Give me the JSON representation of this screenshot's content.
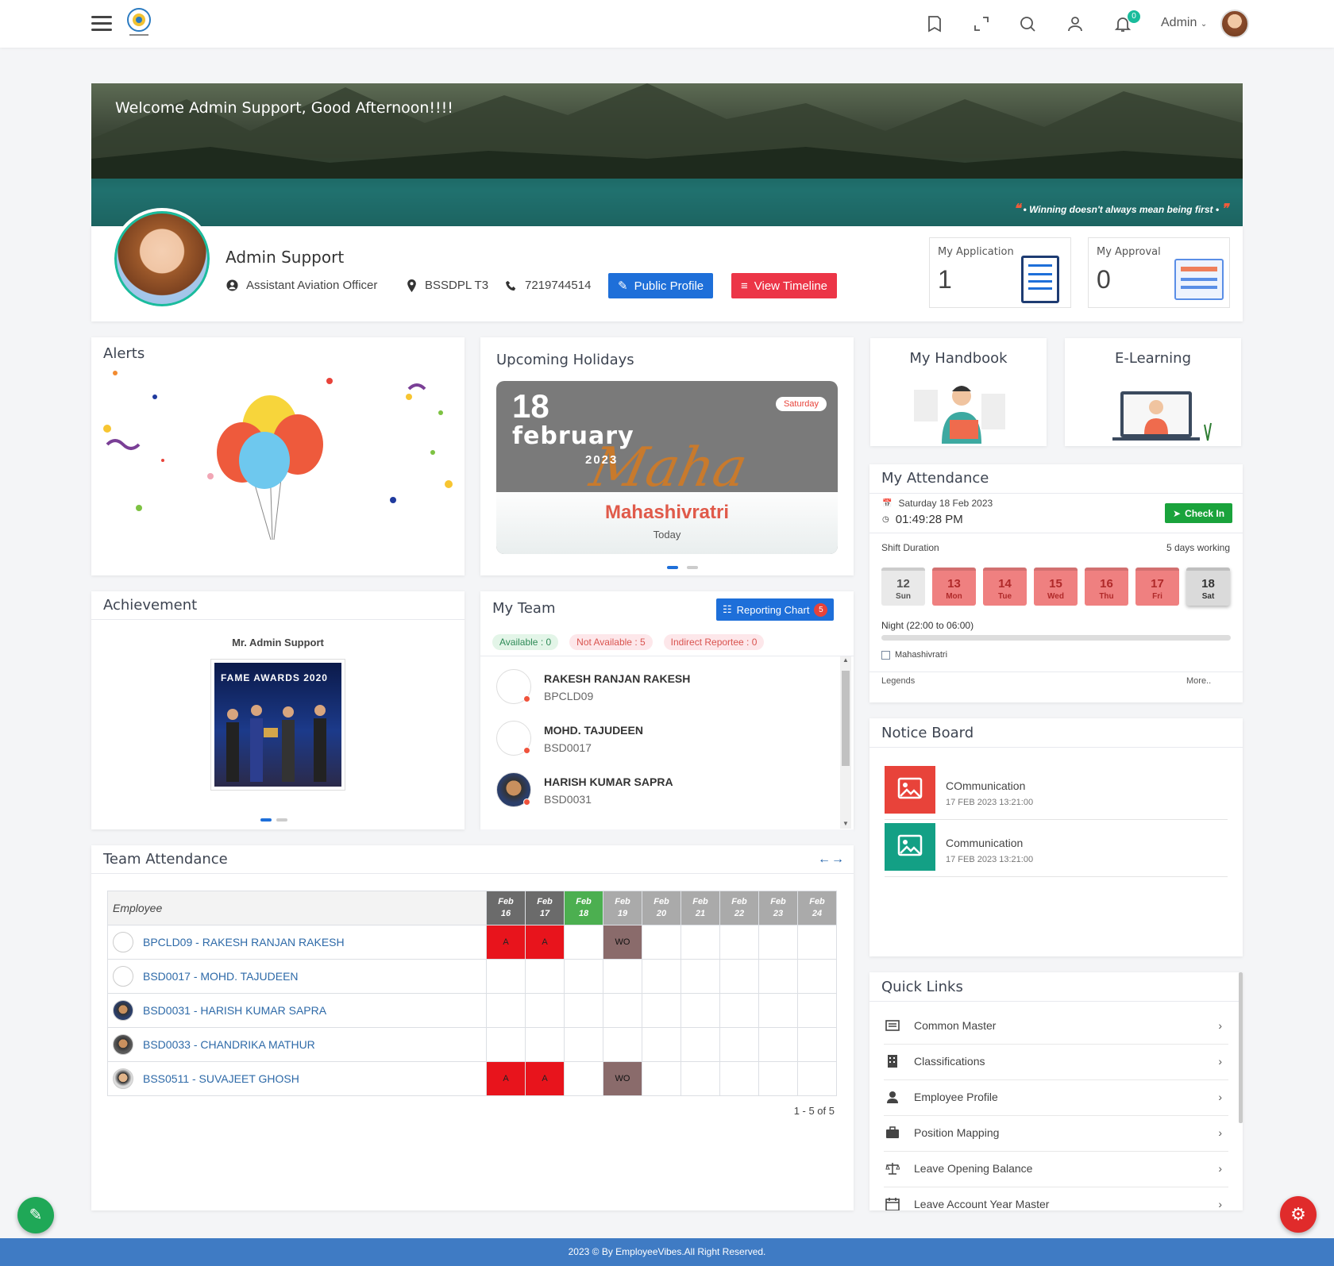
{
  "header": {
    "user_label": "Admin",
    "notification_count": "0"
  },
  "banner": {
    "welcome": "Welcome Admin Support, Good Afternoon!!!!",
    "quote": "• Winning doesn't always mean being first •"
  },
  "profile": {
    "name": "Admin Support",
    "designation": "Assistant Aviation Officer",
    "location": "BSSDPL T3",
    "phone": "7219744514",
    "public_profile_label": "Public Profile",
    "view_timeline_label": "View Timeline"
  },
  "stats": {
    "application": {
      "label": "My Application",
      "value": "1"
    },
    "approval": {
      "label": "My Approval",
      "value": "0"
    }
  },
  "alerts": {
    "title": "Alerts"
  },
  "holidays": {
    "title": "Upcoming Holidays",
    "day": "18",
    "month": "february",
    "year": "2023",
    "weekday": "Saturday",
    "name": "Mahashivratri",
    "when": "Today",
    "bg_text": "Maha"
  },
  "handbook": {
    "title": "My Handbook"
  },
  "elearning": {
    "title": "E-Learning"
  },
  "attendance": {
    "title": "My Attendance",
    "date": "Saturday 18 Feb 2023",
    "time": "01:49:28 PM",
    "checkin_label": "Check In",
    "shift_label": "Shift Duration",
    "working_label": "5 days working",
    "days": [
      {
        "n": "12",
        "w": "Sun",
        "state": "off"
      },
      {
        "n": "13",
        "w": "Mon",
        "state": "absent"
      },
      {
        "n": "14",
        "w": "Tue",
        "state": "absent"
      },
      {
        "n": "15",
        "w": "Wed",
        "state": "absent"
      },
      {
        "n": "16",
        "w": "Thu",
        "state": "absent"
      },
      {
        "n": "17",
        "w": "Fri",
        "state": "absent"
      },
      {
        "n": "18",
        "w": "Sat",
        "state": "today"
      }
    ],
    "shift_name": "Night (22:00 to 06:00)",
    "holiday_legend": "Mahashivratri",
    "legends_label": "Legends",
    "more_label": "More.."
  },
  "achievement": {
    "title": "Achievement",
    "person": "Mr. Admin Support",
    "photo_caption": "FAME AWARDS 2020"
  },
  "team": {
    "title": "My Team",
    "reporting_label": "Reporting Chart",
    "reporting_count": "5",
    "available": "Available : 0",
    "not_available": "Not Available : 5",
    "indirect": "Indirect Reportee : 0",
    "members": [
      {
        "name": "RAKESH RANJAN RAKESH",
        "code": "BPCLD09"
      },
      {
        "name": "MOHD. TAJUDEEN",
        "code": "BSD0017"
      },
      {
        "name": "HARISH KUMAR SAPRA",
        "code": "BSD0031"
      },
      {
        "name": "CHANDRIKA MATHUR",
        "code": ""
      }
    ]
  },
  "notice": {
    "title": "Notice Board",
    "items": [
      {
        "title": "COmmunication",
        "date": "17 FEB 2023 13:21:00",
        "color": "#e8433a"
      },
      {
        "title": "Communication",
        "date": "17 FEB 2023 13:21:00",
        "color": "#13a085"
      }
    ]
  },
  "team_attendance": {
    "title": "Team Attendance",
    "employee_header": "Employee",
    "dates": [
      {
        "m": "Feb",
        "d": "16"
      },
      {
        "m": "Feb",
        "d": "17"
      },
      {
        "m": "Feb",
        "d": "18"
      },
      {
        "m": "Feb",
        "d": "19"
      },
      {
        "m": "Feb",
        "d": "20"
      },
      {
        "m": "Feb",
        "d": "21"
      },
      {
        "m": "Feb",
        "d": "22"
      },
      {
        "m": "Feb",
        "d": "23"
      },
      {
        "m": "Feb",
        "d": "24"
      }
    ],
    "rows": [
      {
        "emp": "BPCLD09 - RAKESH RANJAN RAKESH",
        "cells": [
          "A",
          "A",
          "",
          "WO",
          "",
          "",
          "",
          "",
          ""
        ]
      },
      {
        "emp": "BSD0017 - MOHD. TAJUDEEN",
        "cells": [
          "",
          "",
          "",
          "",
          "",
          "",
          "",
          "",
          ""
        ]
      },
      {
        "emp": "BSD0031 - HARISH KUMAR SAPRA",
        "cells": [
          "",
          "",
          "",
          "",
          "",
          "",
          "",
          "",
          ""
        ]
      },
      {
        "emp": "BSD0033 - CHANDRIKA MATHUR",
        "cells": [
          "",
          "",
          "",
          "",
          "",
          "",
          "",
          "",
          ""
        ]
      },
      {
        "emp": "BSS0511 - SUVAJEET GHOSH",
        "cells": [
          "A",
          "A",
          "",
          "WO",
          "",
          "",
          "",
          "",
          ""
        ]
      }
    ],
    "pager": "1 - 5 of 5",
    "colors": {
      "absent": "#e8141c",
      "weekoff": "#8a6b6b",
      "today_header": "#4caf50",
      "past_header": "#6b6b6b",
      "future_header": "#aaaaaa"
    }
  },
  "quick_links": {
    "title": "Quick Links",
    "items": [
      {
        "label": "Common Master",
        "icon": "list-icon"
      },
      {
        "label": "Classifications",
        "icon": "building-icon"
      },
      {
        "label": "Employee Profile",
        "icon": "user-icon"
      },
      {
        "label": "Position Mapping",
        "icon": "briefcase-icon"
      },
      {
        "label": "Leave Opening Balance",
        "icon": "balance-icon"
      },
      {
        "label": "Leave Account Year Master",
        "icon": "calendar-icon"
      }
    ]
  },
  "footer": {
    "text": "2023 © By EmployeeVibes.All Right Reserved."
  }
}
